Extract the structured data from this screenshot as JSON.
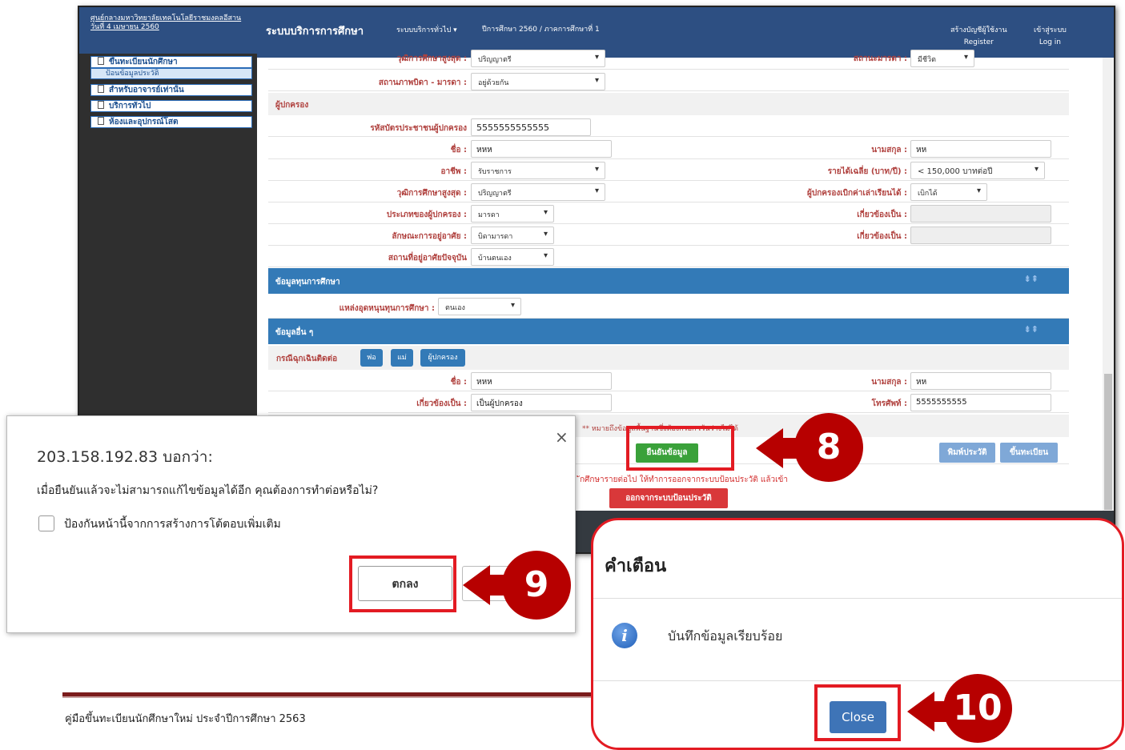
{
  "sidebar": {
    "institution": "ศูนย์กลางมหาวิทยาลัยเทคโนโลยีราชมงคลอีสาน",
    "date": "วันที่ 4 เมษายน 2560",
    "items": [
      {
        "label": "ขึ้นทะเบียนนักศึกษา"
      },
      {
        "label": "ป้อนข้อมูลประวัติ"
      },
      {
        "label": "สำหรับอาจารย์เท่านั้น"
      },
      {
        "label": "บริการทั่วไป"
      },
      {
        "label": "ห้องและอุปกรณ์โสต"
      }
    ]
  },
  "topbar": {
    "title": "ระบบบริการการศึกษา",
    "menu": "ระบบบริการทั่วไป",
    "term": "ปีการศึกษา 2560 / ภาคการศึกษาที่ 1",
    "create_account": "สร้างบัญชีผู้ใช้งาน",
    "register": "Register",
    "login_th": "เข้าสู่ระบบ",
    "login_en": "Log in"
  },
  "form": {
    "top_row": {
      "label": "วุฒิการศึกษาสูงสุด :",
      "value": "ปริญญาตรี",
      "right_label": "สถานะมารดา :",
      "right_value": "มีชีวิต"
    },
    "parents_status": {
      "label": "สถานภาพบิดา - มารดา :",
      "value": "อยู่ด้วยกัน"
    },
    "guardian_header": "ผู้ปกครอง",
    "guardian_id": {
      "label": "รหัสบัตรประชาชนผู้ปกครอง",
      "value": "5555555555555"
    },
    "name": {
      "label": "ชื่อ :",
      "value": "หหห"
    },
    "surname": {
      "label": "นามสกุล :",
      "value": "หห"
    },
    "occupation": {
      "label": "อาชีพ :",
      "value": "รับราชการ"
    },
    "income": {
      "label": "รายได้เฉลี่ย (บาท/ปี) :",
      "value": "< 150,000 บาทต่อปี"
    },
    "education": {
      "label": "วุฒิการศึกษาสูงสุด :",
      "value": "ปริญญาตรี"
    },
    "reimburse": {
      "label": "ผู้ปกครองเบิกค่าเล่าเรียนได้ :",
      "value": "เบิกได้"
    },
    "guardian_type": {
      "label": "ประเภทของผู้ปกครอง :",
      "value": "มารดา"
    },
    "relation1": {
      "label": "เกี่ยวข้องเป็น :",
      "value": ""
    },
    "residence_type": {
      "label": "ลักษณะการอยู่อาศัย :",
      "value": "บิดามารดา"
    },
    "relation2": {
      "label": "เกี่ยวข้องเป็น :",
      "value": ""
    },
    "residence_now": {
      "label": "สถานที่อยู่อาศัยปัจจุบัน",
      "value": "บ้านตนเอง"
    },
    "scholarship_header": "ข้อมูลทุนการศึกษา",
    "scholarship_source": {
      "label": "แหล่งอุดหนุนทุนการศึกษา :",
      "value": "ตนเอง"
    },
    "other_header": "ข้อมูลอื่น ๆ",
    "emergency_label": "กรณีฉุกเฉินติดต่อ",
    "emergency_buttons": [
      "พ่อ",
      "แม่",
      "ผู้ปกครอง"
    ],
    "em_name": {
      "label": "ชื่อ :",
      "value": "หหห"
    },
    "em_surname": {
      "label": "นามสกุล :",
      "value": "หห"
    },
    "em_relation": {
      "label": "เกี่ยวข้องเป็น :",
      "value": "เป็นผู้ปกครอง"
    },
    "em_phone": {
      "label": "โทรศัพท์ :",
      "value": "5555555555"
    },
    "note": "** หมายถึงข้อมูลพื้นฐานซึ่งต้องกรอก เว้นว่างไม่ได้",
    "confirm_button": "ยืนยันข้อมูล",
    "print_button": "พิมพ์ประวัติ",
    "register_button": "ขึ้นทะเบียน",
    "footer_note": "ักศึกษารายต่อไป ให้ทำการออกจากระบบป้อนประวัติ แล้วเข้า",
    "logout_button": "ออกจากระบบป้อนประวัติ",
    "arrows": "⇟⇞"
  },
  "dialog": {
    "title": "203.158.192.83 บอกว่า:",
    "message": "เมื่อยืนยันแล้วจะไม่สามารถแก้ไขข้อมูลได้อีก คุณต้องการทำต่อหรือไม่?",
    "checkbox_label": "ป้องกันหน้านี้จากการสร้างการโต้ตอบเพิ่มเติม",
    "ok_button": "ตกลง",
    "close_symbol": "×"
  },
  "modal": {
    "title": "คำเตือน",
    "message": "บันทึกข้อมูลเรียบร้อย",
    "close_button": "Close"
  },
  "steps": [
    "8",
    "9",
    "10"
  ],
  "footer": {
    "text": "คู่มือขึ้นทะเบียนนักศึกษาใหม่ ประจำปีการศึกษา 2563"
  },
  "colors": {
    "accent": "#2d4f82",
    "section_blue": "#337ab7",
    "callout_red": "#e31b23",
    "step_red": "#b70000",
    "confirm_green": "#3aa13a",
    "logout_red": "#d9383a"
  }
}
